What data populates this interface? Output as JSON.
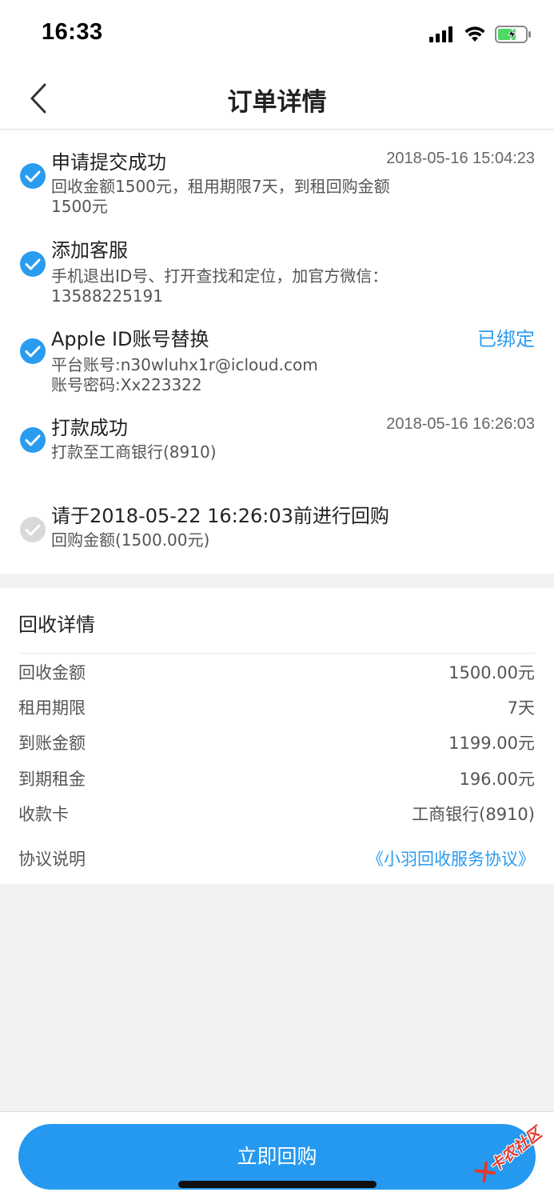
{
  "status_bar": {
    "time": "16:33",
    "icons": [
      "signal-icon",
      "wifi-icon",
      "battery-charging-icon"
    ]
  },
  "nav": {
    "title": "订单详情",
    "back_icon": "chevron-left-icon"
  },
  "timeline": {
    "steps": [
      {
        "title": "申请提交成功",
        "time": "2018-05-16 15:04:23",
        "desc_lines": [
          "回收金额1500元，租用期限7天，到租回购金额",
          "1500元"
        ],
        "completed": true
      },
      {
        "title": "添加客服",
        "desc_lines": [
          "手机退出ID号、打开查找和定位，加官方微信：",
          "13588225191"
        ],
        "completed": true
      },
      {
        "title": "Apple ID账号替换",
        "status": "已绑定",
        "desc_lines": [
          "平台账号:n30wluhx1r@icloud.com",
          "账号密码:Xx223322"
        ],
        "completed": true
      },
      {
        "title": "打款成功",
        "time": "2018-05-16 16:26:03",
        "desc_lines": [
          "打款至工商银行(8910)"
        ],
        "completed": true
      },
      {
        "title": "请于2018-05-22 16:26:03前进行回购",
        "desc_lines": [
          "回购金额(1500.00元)"
        ],
        "completed": false
      }
    ]
  },
  "recycle_details": {
    "title": "回收详情",
    "rows": [
      {
        "label": "回收金额",
        "value": "1500.00元"
      },
      {
        "label": "租用期限",
        "value": "7天"
      },
      {
        "label": "到账金额",
        "value": "1199.00元"
      },
      {
        "label": "到期租金",
        "value": "196.00元"
      },
      {
        "label": "收款卡",
        "value": "工商银行(8910)"
      }
    ],
    "agreement": {
      "label": "协议说明",
      "link": "《小羽回收服务协议》"
    }
  },
  "bottom": {
    "buy_button": "立即回购"
  },
  "watermark": {
    "text": "卡农社区"
  },
  "colors": {
    "accent": "#2599ef",
    "link": "#2a9cf0",
    "check_done": "#2a9cf0",
    "check_pending": "#d9d9d9",
    "page_bg": "#f2f2f2"
  }
}
